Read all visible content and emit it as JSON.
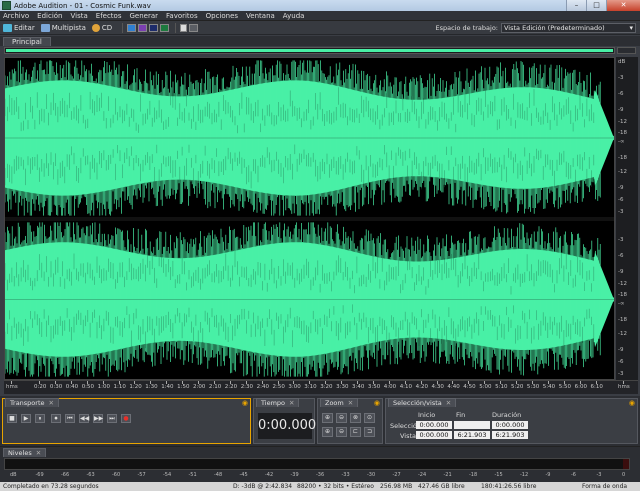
{
  "window": {
    "title": "Adobe Audition - 01 - Cosmic Funk.wav",
    "controls": [
      "–",
      "□",
      "✕"
    ]
  },
  "menu": [
    "Archivo",
    "Edición",
    "Vista",
    "Efectos",
    "Generar",
    "Favoritos",
    "Opciones",
    "Ventana",
    "Ayuda"
  ],
  "toolbar": {
    "editar": "Editar",
    "multipista": "Multipista",
    "cd": "CD",
    "workspace_label": "Espacio de trabajo:",
    "workspace_value": "Vista Edición (Predeterminado)"
  },
  "main_tab": "Principal",
  "colors": {
    "waveform": "#49f0a6",
    "background": "#000000",
    "accent": "#e8a400"
  },
  "db_scale": {
    "unit": "dB",
    "labels": [
      "dB",
      "-3",
      "-6",
      "-9",
      "-12",
      "-18",
      "-∞",
      "-18",
      "-12",
      "-9",
      "-6",
      "-3"
    ]
  },
  "time_ruler": {
    "labels": [
      "hms",
      "0:20",
      "0:30",
      "0:40",
      "0:50",
      "1:00",
      "1:10",
      "1:20",
      "1:30",
      "1:40",
      "1:50",
      "2:00",
      "2:10",
      "2:20",
      "2:30",
      "2:40",
      "2:50",
      "3:00",
      "3:10",
      "3:20",
      "3:30",
      "3:40",
      "3:50",
      "4:00",
      "4:10",
      "4:20",
      "4:30",
      "4:40",
      "4:50",
      "5:00",
      "5:10",
      "5:20",
      "5:30",
      "5:40",
      "5:50",
      "6:00",
      "6:10",
      "hms"
    ]
  },
  "transport": {
    "tab": "Transporte",
    "buttons": [
      "■",
      "▶",
      "⏸",
      "⏺",
      "⏮",
      "◀◀",
      "▶▶",
      "⏭",
      "●"
    ]
  },
  "tiempo": {
    "tab": "Tiempo",
    "value": "0:00.000"
  },
  "zoom": {
    "tab": "Zoom"
  },
  "selection": {
    "tab": "Selección/vista",
    "headers": [
      "Inicio",
      "Fin",
      "Duración"
    ],
    "rows": [
      {
        "label": "Selección",
        "inicio": "0:00.000",
        "fin": "",
        "duracion": "0:00.000"
      },
      {
        "label": "Vista",
        "inicio": "0:00.000",
        "fin": "6:21.903",
        "duracion": "6:21.903"
      }
    ]
  },
  "levels": {
    "tab": "Niveles",
    "scale": [
      "dB",
      "-69",
      "-66",
      "-63",
      "-60",
      "-57",
      "-54",
      "-51",
      "-48",
      "-45",
      "-42",
      "-39",
      "-36",
      "-33",
      "-30",
      "-27",
      "-24",
      "-21",
      "-18",
      "-15",
      "-12",
      "-9",
      "-6",
      "-3",
      "0"
    ]
  },
  "status": {
    "completed": "Completado en 73.28 segundos",
    "peak": "D: -3dB @ 2:42.834",
    "format": "88200 • 32 bits • Estéreo",
    "size": "256.98 MB",
    "free": "427.46 GB libre",
    "free_time": "180:41:26.56 libre",
    "view": "Forma de onda"
  }
}
